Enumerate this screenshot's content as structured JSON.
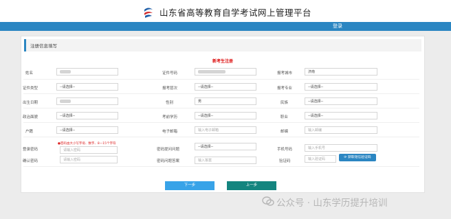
{
  "header": {
    "site_title": "山东省高等教育自学考试网上管理平台",
    "login": "登录"
  },
  "panel": {
    "title": "注册信息填写",
    "subtitle": "新考生注册"
  },
  "form": {
    "name_label": "姓名",
    "id_type_label": "证件类型",
    "id_number_label": "证件号码",
    "apply_city_label": "报考城市",
    "apply_city_value": "济南",
    "grade_label": "证件类型",
    "grade_select": "--请选择--",
    "level_label": "报考层次",
    "level_select": "--请选择--",
    "major_label": "报考专业",
    "major_select": "--请选择--",
    "birth_label": "出生日期",
    "gender_label": "性别",
    "gender_value": "男",
    "ethnicity_label": "民族",
    "ethnicity_select": "--请选择--",
    "political_label": "政治面貌",
    "political_select": "--请选择--",
    "education_label": "考前学历",
    "education_select": "--请选择--",
    "occupation_label": "职业",
    "occupation_select": "--请选择--",
    "hukou_label": "户籍",
    "hukou_select": "--请选择--",
    "email_label": "电子邮箱",
    "email_placeholder": "输入电子邮箱",
    "postcode_label": "邮编",
    "postcode_placeholder": "输入邮编",
    "password_label": "登录密码",
    "password_tip": "●密码由大小写字母、数字、8—15个字符",
    "password_placeholder": "请输入密码",
    "confirm_label": "确认密码",
    "confirm_placeholder": "请输入密码",
    "question_label": "密码提问问题",
    "question_select": "--请选择--",
    "answer_label": "密码问题答案",
    "answer_placeholder": "输入答案",
    "phone_label": "手机号码",
    "phone_placeholder": "输入手机号",
    "code_label": "验证码",
    "code_placeholder": "输入验证码",
    "sms_button": "获取短信验证码"
  },
  "buttons": {
    "next": "下一步",
    "prev": "上一步"
  },
  "watermark": "公众号 · 山东学历提升培训"
}
